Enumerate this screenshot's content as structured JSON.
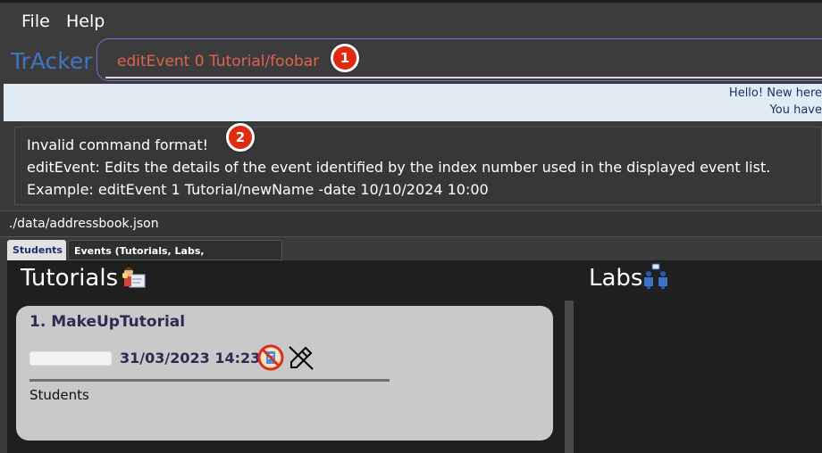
{
  "menu": {
    "file": "File",
    "help": "Help"
  },
  "app": {
    "name": "TrAcker"
  },
  "command": {
    "text": "editEvent 0 Tutorial/foobar"
  },
  "badges": {
    "first": "1",
    "second": "2"
  },
  "welcome": {
    "line1": "Hello! New here",
    "line2": "You have"
  },
  "result": {
    "line1": "Invalid command format!",
    "line2": "editEvent: Edits the details of the event identified by the index number used in the displayed event list.",
    "line3": "Example: editEvent 1 Tutorial/newName -date 10/10/2024 10:00"
  },
  "status": {
    "path": "./data/addressbook.json"
  },
  "tabs": {
    "students": "Students",
    "events": "Events (Tutorials, Labs, Consultations)"
  },
  "sections": {
    "tutorials": "Tutorials",
    "labs": "Labs"
  },
  "tutorial_card": {
    "title": "1.  MakeUpTutorial",
    "date": "31/03/2023 14:23",
    "students_label": "Students"
  },
  "icons": {
    "tutorial": "tutor-with-board-icon",
    "lab": "lab-people-icon",
    "no_notes": "no-notes-icon",
    "no_edit": "no-pencil-icon"
  },
  "colors": {
    "accent": "#3f74c6",
    "command_text": "#e0634f",
    "badge": "#df2c10",
    "card": "#c9c9c9"
  }
}
